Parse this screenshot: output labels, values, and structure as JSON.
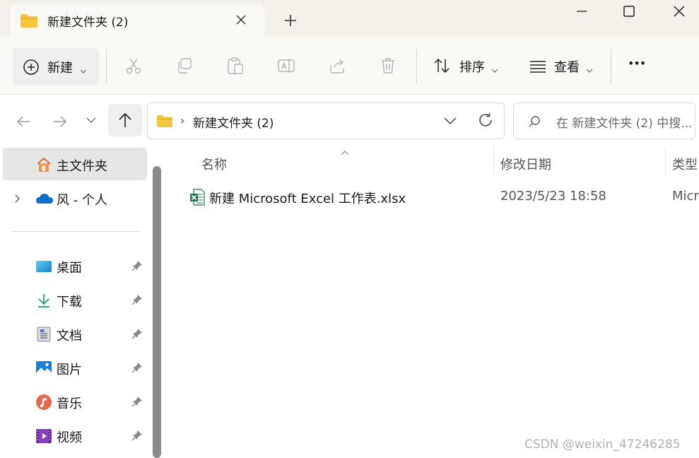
{
  "window": {
    "tab_title": "新建文件夹 (2)",
    "controls": [
      "minimize",
      "maximize",
      "close"
    ]
  },
  "toolbar": {
    "new_label": "新建",
    "sort_label": "排序",
    "view_label": "查看",
    "more_label": "•••",
    "action_icons": [
      "cut-icon",
      "copy-icon",
      "paste-icon",
      "rename-icon",
      "share-icon",
      "delete-icon"
    ]
  },
  "address_bar": {
    "separator": "›",
    "path": "新建文件夹 (2)",
    "search_placeholder": "在 新建文件夹 (2) 中搜..."
  },
  "sidebar": {
    "home_label": "主文件夹",
    "cloud_label": "风 - 个人",
    "pinned": [
      {
        "label": "桌面",
        "icon": "desktop-icon"
      },
      {
        "label": "下载",
        "icon": "download-icon"
      },
      {
        "label": "文档",
        "icon": "documents-icon"
      },
      {
        "label": "图片",
        "icon": "pictures-icon"
      },
      {
        "label": "音乐",
        "icon": "music-icon"
      },
      {
        "label": "视频",
        "icon": "videos-icon"
      }
    ]
  },
  "file_list": {
    "columns": {
      "name": "名称",
      "modified": "修改日期",
      "type": "类型"
    },
    "rows": [
      {
        "name": "新建 Microsoft Excel 工作表.xlsx",
        "modified": "2023/5/23 18:58",
        "type": "Micr"
      }
    ]
  },
  "watermark": "CSDN @weixin_47246285",
  "colors": {
    "titlebar_bg": "#f3f0e9",
    "toolbar_bg": "#faf9f6",
    "selected_bg": "#e6e6e6",
    "folder_yellow": "#f4c53e",
    "excel_green": "#1d7a45",
    "onedrive_blue": "#0f6fc6"
  }
}
